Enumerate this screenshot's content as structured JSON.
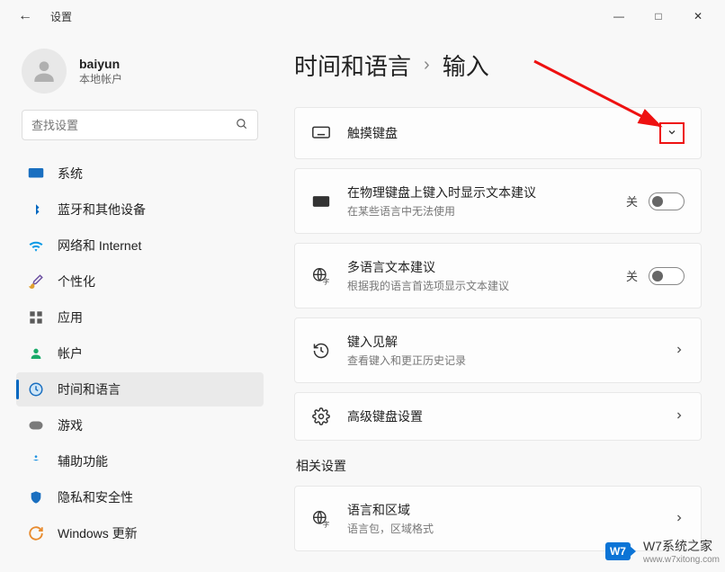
{
  "window": {
    "back_icon": "←",
    "title": "设置",
    "controls": {
      "min": "—",
      "max": "□",
      "close": "✕"
    }
  },
  "user": {
    "name": "baiyun",
    "sub": "本地帐户"
  },
  "search": {
    "placeholder": "查找设置"
  },
  "nav": [
    {
      "icon": "system",
      "label": "系统",
      "color": "#0078d4"
    },
    {
      "icon": "bluetooth",
      "label": "蓝牙和其他设备",
      "color": "#0067c0"
    },
    {
      "icon": "wifi",
      "label": "网络和 Internet",
      "color": "#0a9ae6"
    },
    {
      "icon": "brush",
      "label": "个性化",
      "color": "#6b4ea0"
    },
    {
      "icon": "apps",
      "label": "应用",
      "color": "#5a5a5a"
    },
    {
      "icon": "person",
      "label": "帐户",
      "color": "#1aab6a"
    },
    {
      "icon": "clock",
      "label": "时间和语言",
      "color": "#1a6fc0",
      "active": true
    },
    {
      "icon": "game",
      "label": "游戏",
      "color": "#7a7a7a"
    },
    {
      "icon": "access",
      "label": "辅助功能",
      "color": "#1a8fe0"
    },
    {
      "icon": "shield",
      "label": "隐私和安全性",
      "color": "#1a6fc0"
    },
    {
      "icon": "update",
      "label": "Windows 更新",
      "color": "#e88b2e"
    }
  ],
  "breadcrumb": {
    "a": "时间和语言",
    "sep": "›",
    "b": "输入"
  },
  "cards": {
    "touch": {
      "title": "触摸键盘"
    },
    "phys": {
      "title": "在物理键盘上键入时显示文本建议",
      "sub": "在某些语言中无法使用",
      "state": "关"
    },
    "multi": {
      "title": "多语言文本建议",
      "sub": "根据我的语言首选项显示文本建议",
      "state": "关"
    },
    "insight": {
      "title": "键入见解",
      "sub": "查看键入和更正历史记录"
    },
    "adv": {
      "title": "高级键盘设置"
    },
    "lang": {
      "title": "语言和区域",
      "sub": "语言包，区域格式"
    }
  },
  "related_header": "相关设置",
  "watermark": {
    "badge": "W7",
    "text": "W7系统之家",
    "url": "www.w7xitong.com"
  }
}
